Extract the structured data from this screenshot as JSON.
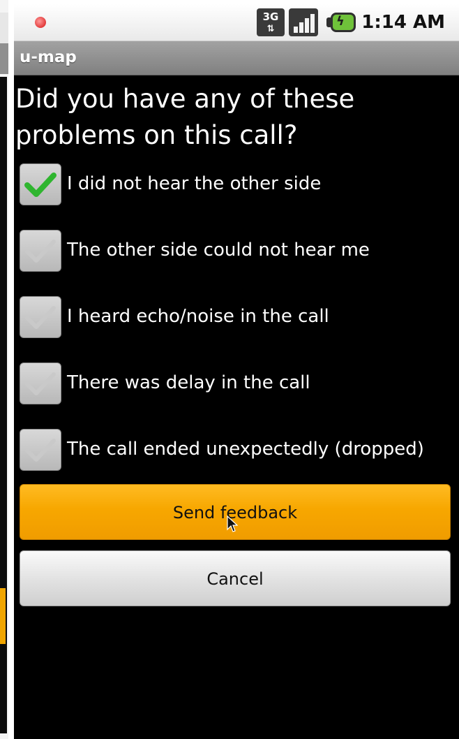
{
  "status_bar": {
    "network_icon": "3g-data-icon",
    "network_label": "3G",
    "signal_icon": "signal-strength-icon",
    "battery_icon": "battery-charging-icon",
    "time": "1:14 AM"
  },
  "app": {
    "title": "u-map"
  },
  "dialog": {
    "question": "Did you have any of these problems on this call?",
    "options": [
      {
        "label": "I did not hear the other side",
        "checked": true
      },
      {
        "label": "The other side could not hear me",
        "checked": false
      },
      {
        "label": "I heard echo/noise in the call",
        "checked": false
      },
      {
        "label": "There was delay in the call",
        "checked": false
      },
      {
        "label": "The call ended unexpectedly (dropped)",
        "checked": false
      }
    ],
    "send_label": "Send feedback",
    "cancel_label": "Cancel"
  },
  "colors": {
    "send_button": "#f7a700",
    "check_on": "#2fb52f",
    "check_off": "#a9a9a9",
    "background": "#000000"
  }
}
